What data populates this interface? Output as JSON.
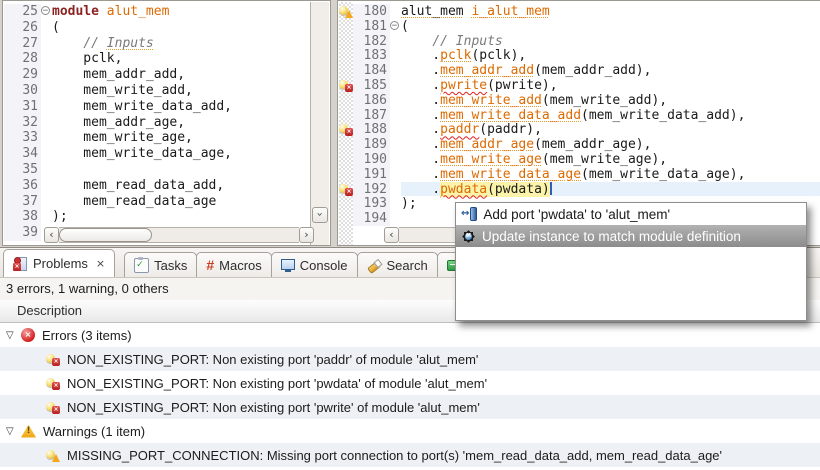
{
  "colors": {
    "keyword": "#8b2323",
    "identifier": "#dd6a02",
    "comment": "#7a7a7a",
    "error_squiggle": "#e02020",
    "warning_underline": "#e39a2b",
    "occurrence_highlight": "#fbf3a9",
    "current_line": "#e7f1fc",
    "selected_menu_item": "#8c8c8c",
    "row_shade": "#edf0f4",
    "error_red": "#c11b1b",
    "warning_yellow": "#eda310"
  },
  "editors": {
    "left": {
      "lines": [
        {
          "num": "25",
          "fold": true,
          "tokens": [
            {
              "t": "module",
              "c": "kw"
            },
            {
              "t": " ",
              "c": "pl"
            },
            {
              "t": "alut_mem",
              "c": "id"
            }
          ]
        },
        {
          "num": "26",
          "tokens": [
            {
              "t": "(",
              "c": "pl"
            }
          ]
        },
        {
          "num": "27",
          "tokens": [
            {
              "t": "    ",
              "c": "pl"
            },
            {
              "t": "// ",
              "c": "cm"
            },
            {
              "t": "Inputs",
              "c": "cm wu"
            }
          ]
        },
        {
          "num": "28",
          "tokens": [
            {
              "t": "    pclk,",
              "c": "pl"
            }
          ]
        },
        {
          "num": "29",
          "tokens": [
            {
              "t": "    mem_addr_add,",
              "c": "pl"
            }
          ]
        },
        {
          "num": "30",
          "tokens": [
            {
              "t": "    mem_write_add,",
              "c": "pl"
            }
          ]
        },
        {
          "num": "31",
          "tokens": [
            {
              "t": "    mem_write_data_add,",
              "c": "pl"
            }
          ]
        },
        {
          "num": "32",
          "tokens": [
            {
              "t": "    mem_addr_age,",
              "c": "pl"
            }
          ]
        },
        {
          "num": "33",
          "tokens": [
            {
              "t": "    mem_write_age,",
              "c": "pl"
            }
          ]
        },
        {
          "num": "34",
          "tokens": [
            {
              "t": "    mem_write_data_age,",
              "c": "pl"
            }
          ]
        },
        {
          "num": "35",
          "tokens": []
        },
        {
          "num": "36",
          "tokens": [
            {
              "t": "    mem_read_data_add,",
              "c": "pl"
            }
          ]
        },
        {
          "num": "37",
          "tokens": [
            {
              "t": "    mem_read_data_age",
              "c": "pl"
            }
          ]
        },
        {
          "num": "38",
          "tokens": [
            {
              "t": ");",
              "c": "pl"
            }
          ]
        },
        {
          "num": "39",
          "tokens": []
        }
      ]
    },
    "right": {
      "lines": [
        {
          "num": "180",
          "icon": "warn",
          "tokens": [
            {
              "t": "alut_mem",
              "c": "pl wu"
            },
            {
              "t": " ",
              "c": "pl"
            },
            {
              "t": "i_alut_mem",
              "c": "id wu"
            }
          ]
        },
        {
          "num": "181",
          "fold": true,
          "tokens": [
            {
              "t": "(",
              "c": "pl"
            }
          ]
        },
        {
          "num": "182",
          "tokens": [
            {
              "t": "    ",
              "c": "pl"
            },
            {
              "t": "// Inputs",
              "c": "cm"
            }
          ]
        },
        {
          "num": "183",
          "tokens": [
            {
              "t": "    .",
              "c": "pl"
            },
            {
              "t": "pclk",
              "c": "id wu"
            },
            {
              "t": "(pclk),",
              "c": "pl"
            }
          ]
        },
        {
          "num": "184",
          "tokens": [
            {
              "t": "    .",
              "c": "pl"
            },
            {
              "t": "mem_addr_add",
              "c": "id wu"
            },
            {
              "t": "(mem_addr_add),",
              "c": "pl"
            }
          ]
        },
        {
          "num": "185",
          "icon": "err",
          "tokens": [
            {
              "t": "    .",
              "c": "pl"
            },
            {
              "t": "pwrite",
              "c": "id es"
            },
            {
              "t": "(pwrite),",
              "c": "pl"
            }
          ]
        },
        {
          "num": "186",
          "tokens": [
            {
              "t": "    .",
              "c": "pl"
            },
            {
              "t": "mem_write_add",
              "c": "id wu"
            },
            {
              "t": "(mem_write_add),",
              "c": "pl"
            }
          ]
        },
        {
          "num": "187",
          "tokens": [
            {
              "t": "    .",
              "c": "pl"
            },
            {
              "t": "mem_write_data_add",
              "c": "id wu"
            },
            {
              "t": "(mem_write_data_add),",
              "c": "pl"
            }
          ]
        },
        {
          "num": "188",
          "icon": "err",
          "tokens": [
            {
              "t": "    .",
              "c": "pl"
            },
            {
              "t": "paddr",
              "c": "id es"
            },
            {
              "t": "(paddr),",
              "c": "pl"
            }
          ]
        },
        {
          "num": "189",
          "tokens": [
            {
              "t": "    .",
              "c": "pl"
            },
            {
              "t": "mem_addr_age",
              "c": "id wu"
            },
            {
              "t": "(mem_addr_age),",
              "c": "pl"
            }
          ]
        },
        {
          "num": "190",
          "tokens": [
            {
              "t": "    .",
              "c": "pl"
            },
            {
              "t": "mem_write_age",
              "c": "id wu"
            },
            {
              "t": "(mem_write_age),",
              "c": "pl"
            }
          ]
        },
        {
          "num": "191",
          "tokens": [
            {
              "t": "    .",
              "c": "pl"
            },
            {
              "t": "mem_write_data_age",
              "c": "id wu"
            },
            {
              "t": "(mem_write_data_age),",
              "c": "pl"
            }
          ]
        },
        {
          "num": "192",
          "icon": "err",
          "current": true,
          "tokens": [
            {
              "t": "    .",
              "c": "pl"
            },
            {
              "t": "pwdata",
              "c": "id es hl"
            },
            {
              "t": "(pwdata)",
              "c": "pl hl"
            },
            {
              "cursor": true
            }
          ]
        },
        {
          "num": "193",
          "tokens": [
            {
              "t": ");",
              "c": "pl"
            }
          ]
        },
        {
          "num": "194",
          "tokens": []
        }
      ]
    }
  },
  "quickfix_menu": {
    "items": [
      {
        "label": "Add port 'pwdata' to 'alut_mem'",
        "icon": "add-port",
        "selected": false
      },
      {
        "label": "Update instance to match module definition",
        "icon": "update-instance",
        "selected": true
      }
    ]
  },
  "bottom_panel": {
    "tabs": [
      {
        "label": "Problems",
        "icon": "problems",
        "active": true,
        "closable": true
      },
      {
        "label": "Tasks",
        "icon": "tasks",
        "gap": true
      },
      {
        "label": "Macros",
        "icon": "hash",
        "icon_glyph": "#"
      },
      {
        "label": "Console",
        "icon": "console"
      },
      {
        "label": "Search",
        "icon": "search"
      },
      {
        "label": "",
        "icon": "green"
      }
    ],
    "summary": "3 errors, 1 warning, 0 others",
    "column_header": "Description",
    "tree": [
      {
        "type": "group",
        "icon": "error",
        "label": "Errors (3 items)",
        "expanded": true,
        "shade": false
      },
      {
        "type": "item",
        "icon": "error-quickfix",
        "label": "NON_EXISTING_PORT: Non existing port 'paddr' of module 'alut_mem'",
        "shade": true
      },
      {
        "type": "item",
        "icon": "error-quickfix",
        "label": "NON_EXISTING_PORT: Non existing port 'pwdata' of module 'alut_mem'",
        "shade": false
      },
      {
        "type": "item",
        "icon": "error-quickfix",
        "label": "NON_EXISTING_PORT: Non existing port 'pwrite' of module 'alut_mem'",
        "shade": true
      },
      {
        "type": "group",
        "icon": "warning",
        "label": "Warnings (1 item)",
        "expanded": true,
        "shade": false
      },
      {
        "type": "item",
        "icon": "warning-quickfix",
        "label": "MISSING_PORT_CONNECTION: Missing port connection to port(s) 'mem_read_data_add, mem_read_data_age'",
        "shade": true
      }
    ]
  }
}
